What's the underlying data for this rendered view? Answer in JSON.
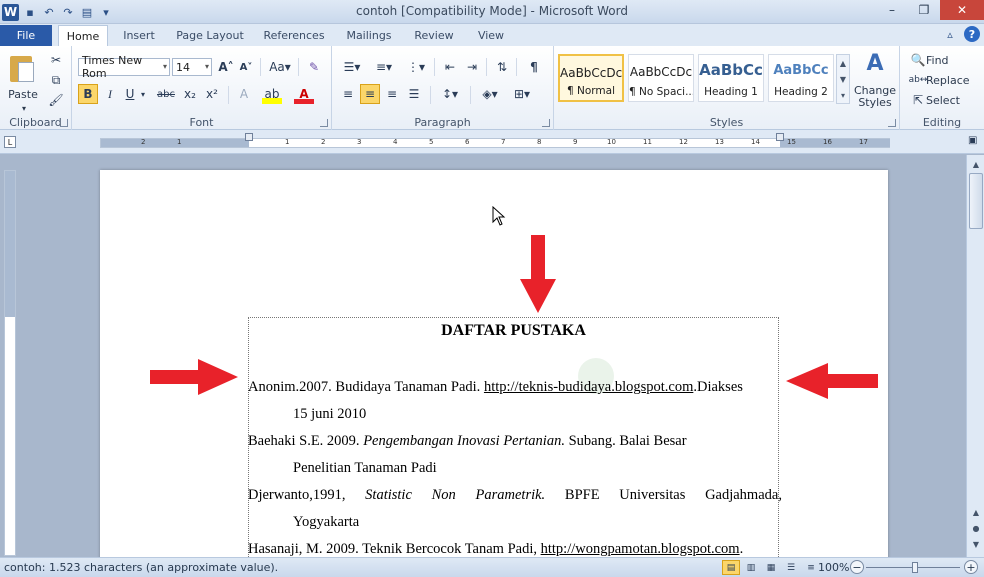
{
  "window": {
    "title": "contoh [Compatibility Mode] - Microsoft Word",
    "minimize": "–",
    "restore": "❐",
    "close": "✕"
  },
  "tabs": [
    {
      "label": "File"
    },
    {
      "label": "Home"
    },
    {
      "label": "Insert"
    },
    {
      "label": "Page Layout"
    },
    {
      "label": "References"
    },
    {
      "label": "Mailings"
    },
    {
      "label": "Review"
    },
    {
      "label": "View"
    }
  ],
  "ribbon": {
    "clipboard": {
      "label": "Clipboard",
      "paste": "Paste"
    },
    "font": {
      "label": "Font",
      "font_name": "Times New Rom",
      "font_size": "14",
      "case_label": "Aa"
    },
    "paragraph": {
      "label": "Paragraph"
    },
    "styles": {
      "label": "Styles",
      "items": [
        {
          "sample": "AaBbCcDc",
          "name": "¶ Normal"
        },
        {
          "sample": "AaBbCcDc",
          "name": "¶ No Spaci..."
        },
        {
          "sample": "AaBbCc",
          "name": "Heading 1"
        },
        {
          "sample": "AaBbCc",
          "name": "Heading 2"
        }
      ],
      "change_styles": "Change Styles"
    },
    "editing": {
      "label": "Editing",
      "find": "Find",
      "replace": "Replace",
      "select": "Select"
    }
  },
  "ruler": {
    "numbers": [
      "2",
      "1",
      "1",
      "2",
      "3",
      "4",
      "5",
      "6",
      "7",
      "8",
      "9",
      "10",
      "11",
      "12",
      "13",
      "14",
      "15",
      "16",
      "17"
    ]
  },
  "document": {
    "title": "DAFTAR PUSTAKA",
    "entries": [
      {
        "line1_a": "Anonim.2007. Budidaya Tanaman Padi. ",
        "line1_link": "http://teknis-budidaya.blogspot.com",
        "line1_b": ".Diakses",
        "line2": "15 juni 2010"
      },
      {
        "line1_a": "Baehaki S.E. 2009. ",
        "line1_italic": "Pengembangan Inovasi Pertanian.",
        "line1_b": " Subang. Balai Besar",
        "line2": "Penelitian Tanaman Padi"
      },
      {
        "line1_words": [
          "Djerwanto,1991,",
          "Statistic",
          "Non",
          "Parametrik.",
          "BPFE",
          "Universitas",
          "Gadjahmada,"
        ],
        "line2": "Yogyakarta"
      },
      {
        "line1_a": "Hasanaji, M. 2009. Teknik Bercocok Tanam Padi, ",
        "line1_link": "http://wongpamotan.blogspot.com",
        "line1_b": "."
      }
    ]
  },
  "status": {
    "text": "contoh: 1.523 characters (an approximate value).",
    "zoom": "100%"
  },
  "colors": {
    "arrow": "#e8222a",
    "file_tab": "#2a5aa8",
    "title_bar": "#dfe9f5"
  }
}
